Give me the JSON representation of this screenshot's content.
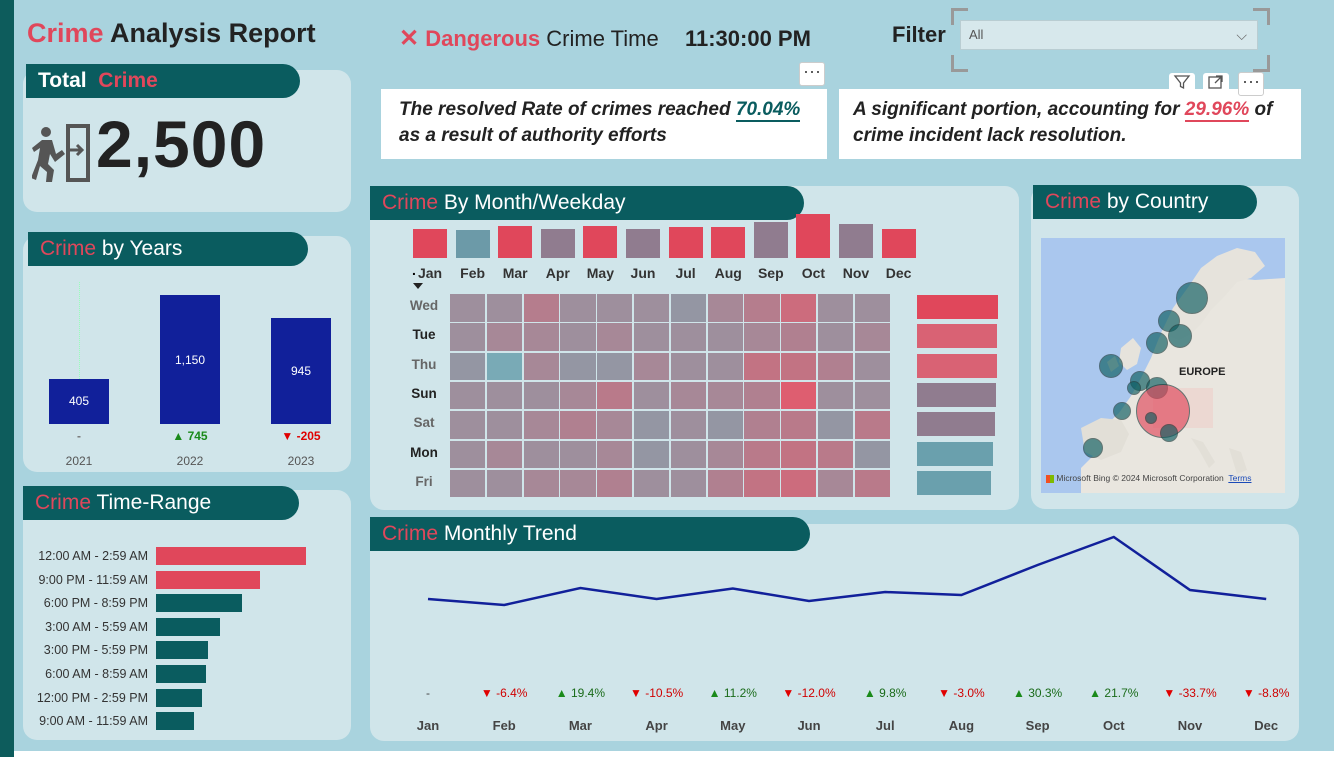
{
  "header": {
    "title_accent": "Crime",
    "title_rest": " Analysis Report",
    "danger_icon": "close-icon",
    "danger_accent": "Dangerous",
    "danger_rest": " Crime Time",
    "danger_value": "11:30:00 PM",
    "filter_label": "Filter",
    "filter_value": "All"
  },
  "notes": {
    "left_text_before": "The resolved Rate of crimes reached ",
    "left_value": "70.04%",
    "left_text_after": " as a result of authority efforts",
    "right_text_before": "A significant portion, accounting for ",
    "right_value": "29.96%",
    "right_text_after": " of crime incident lack resolution.",
    "more_label": "···"
  },
  "total": {
    "label_white": "Total",
    "label_red": "Crime",
    "value": "2,500",
    "icon": "exit-door-icon"
  },
  "years": {
    "title_accent": "Crime",
    "title_rest": " by Years"
  },
  "time_range": {
    "title_accent": "Crime",
    "title_rest": " Time-Range"
  },
  "month_weekday": {
    "title_accent": "Crime",
    "title_rest": " By Month/Weekday",
    "sort_marker": "."
  },
  "country": {
    "title_accent": "Crime",
    "title_rest": " by Country",
    "map_label": "EUROPE",
    "map_credit_brand": "Microsoft Bing",
    "map_credit": "© 2024 Microsoft Corporation",
    "map_terms": "Terms"
  },
  "monthly": {
    "title_accent": "Crime",
    "title_rest": " Monthly Trend"
  },
  "colors": {
    "accent_red": "#e0475b",
    "dark_teal": "#0a5c5f",
    "bar_blue": "#11209a",
    "line_blue": "#11209a",
    "up_green": "#1a8a1a",
    "down_red": "#e00000"
  },
  "chart_data": [
    {
      "id": "crime-by-years",
      "type": "bar",
      "categories": [
        "2021",
        "2022",
        "2023"
      ],
      "values": [
        405,
        1150,
        945
      ],
      "value_labels": [
        "405",
        "1,150",
        "945"
      ],
      "delta_labels": [
        "-",
        "▲ 745",
        "▼ -205"
      ],
      "ylim": [
        0,
        1250
      ]
    },
    {
      "id": "crime-time-range",
      "type": "bar",
      "orientation": "horizontal",
      "categories": [
        "12:00 AM - 2:59 AM",
        "9:00 PM - 11:59 AM",
        "6:00 PM - 8:59 PM",
        "3:00 AM - 5:59 AM",
        "3:00 PM - 5:59 PM",
        "6:00 AM - 8:59 AM",
        "12:00 PM - 2:59 PM",
        "9:00 AM - 11:59 AM"
      ],
      "values": [
        560,
        390,
        320,
        240,
        195,
        185,
        170,
        140
      ],
      "colors": [
        "#e0475b",
        "#e0475b",
        "#0a5c5f",
        "#0a5c5f",
        "#0a5c5f",
        "#0a5c5f",
        "#0a5c5f",
        "#0a5c5f"
      ]
    },
    {
      "id": "crime-by-month-weekday",
      "type": "heatmap",
      "months": [
        "Jan",
        "Feb",
        "Mar",
        "Apr",
        "May",
        "Jun",
        "Jul",
        "Aug",
        "Sep",
        "Oct",
        "Nov",
        "Dec"
      ],
      "days": [
        "Wed",
        "Tue",
        "Thu",
        "Sun",
        "Sat",
        "Mon",
        "Fri"
      ],
      "month_totals": [
        195,
        185,
        215,
        195,
        215,
        195,
        210,
        205,
        245,
        300,
        225,
        190
      ],
      "day_totals": [
        370,
        365,
        365,
        360,
        355,
        345,
        340
      ],
      "day_colors": [
        "#e0475b",
        "#d96274",
        "#d96274",
        "#907c8f",
        "#907c8f",
        "#6aa0ad",
        "#6aa0ad"
      ],
      "month_colors": [
        "#e0475b",
        "#6c9aa8",
        "#e0475b",
        "#907c8f",
        "#e0475b",
        "#907c8f",
        "#e0475b",
        "#e0475b",
        "#907c8f",
        "#e0475b",
        "#907c8f",
        "#e0475b"
      ],
      "matrix": [
        [
          30,
          30,
          35,
          30,
          30,
          30,
          28,
          32,
          35,
          40,
          30,
          30
        ],
        [
          30,
          32,
          32,
          30,
          32,
          30,
          30,
          30,
          32,
          34,
          30,
          32
        ],
        [
          28,
          22,
          32,
          28,
          28,
          32,
          30,
          30,
          38,
          38,
          34,
          30
        ],
        [
          30,
          30,
          30,
          32,
          36,
          30,
          32,
          32,
          34,
          44,
          30,
          30
        ],
        [
          30,
          30,
          32,
          34,
          32,
          28,
          30,
          28,
          34,
          36,
          28,
          36
        ],
        [
          30,
          32,
          30,
          30,
          32,
          28,
          30,
          32,
          36,
          38,
          36,
          28
        ],
        [
          30,
          30,
          32,
          32,
          34,
          30,
          30,
          34,
          38,
          40,
          32,
          36
        ]
      ]
    },
    {
      "id": "crime-by-country",
      "type": "scatter",
      "points": [
        {
          "lon": 14,
          "lat": 62,
          "size": 16,
          "color": "#0a5c5f"
        },
        {
          "lon": 10,
          "lat": 59,
          "size": 11,
          "color": "#0a5c5f"
        },
        {
          "lon": 12,
          "lat": 57,
          "size": 12,
          "color": "#0a5c5f"
        },
        {
          "lon": 8,
          "lat": 56,
          "size": 11,
          "color": "#0a5c5f"
        },
        {
          "lon": 0,
          "lat": 53,
          "size": 12,
          "color": "#0a5c5f"
        },
        {
          "lon": 5,
          "lat": 51,
          "size": 10,
          "color": "#0a5c5f"
        },
        {
          "lon": 8,
          "lat": 50,
          "size": 11,
          "color": "#0a5c5f"
        },
        {
          "lon": 4,
          "lat": 50,
          "size": 7,
          "color": "#0a5c5f"
        },
        {
          "lon": 9,
          "lat": 47,
          "size": 27,
          "color": "#e0475b"
        },
        {
          "lon": 2,
          "lat": 47,
          "size": 9,
          "color": "#0a5c5f"
        },
        {
          "lon": 7,
          "lat": 46,
          "size": 6,
          "color": "#0a5c5f"
        },
        {
          "lon": 10,
          "lat": 44,
          "size": 9,
          "color": "#0a5c5f"
        },
        {
          "lon": -3,
          "lat": 42,
          "size": 10,
          "color": "#0a5c5f"
        }
      ]
    },
    {
      "id": "crime-monthly-trend",
      "type": "line",
      "categories": [
        "Jan",
        "Feb",
        "Mar",
        "Apr",
        "May",
        "Jun",
        "Jul",
        "Aug",
        "Sep",
        "Oct",
        "Nov",
        "Dec"
      ],
      "values": [
        190,
        178,
        212,
        190,
        211,
        186,
        204,
        198,
        258,
        314,
        208,
        190
      ],
      "ylim": [
        60,
        320
      ],
      "pct_labels": [
        "-",
        "▼ -6.4%",
        "▲ 19.4%",
        "▼ -10.5%",
        "▲ 11.2%",
        "▼ -12.0%",
        "▲ 9.8%",
        "▼ -3.0%",
        "▲ 30.3%",
        "▲ 21.7%",
        "▼ -33.7%",
        "▼ -8.8%"
      ]
    }
  ]
}
